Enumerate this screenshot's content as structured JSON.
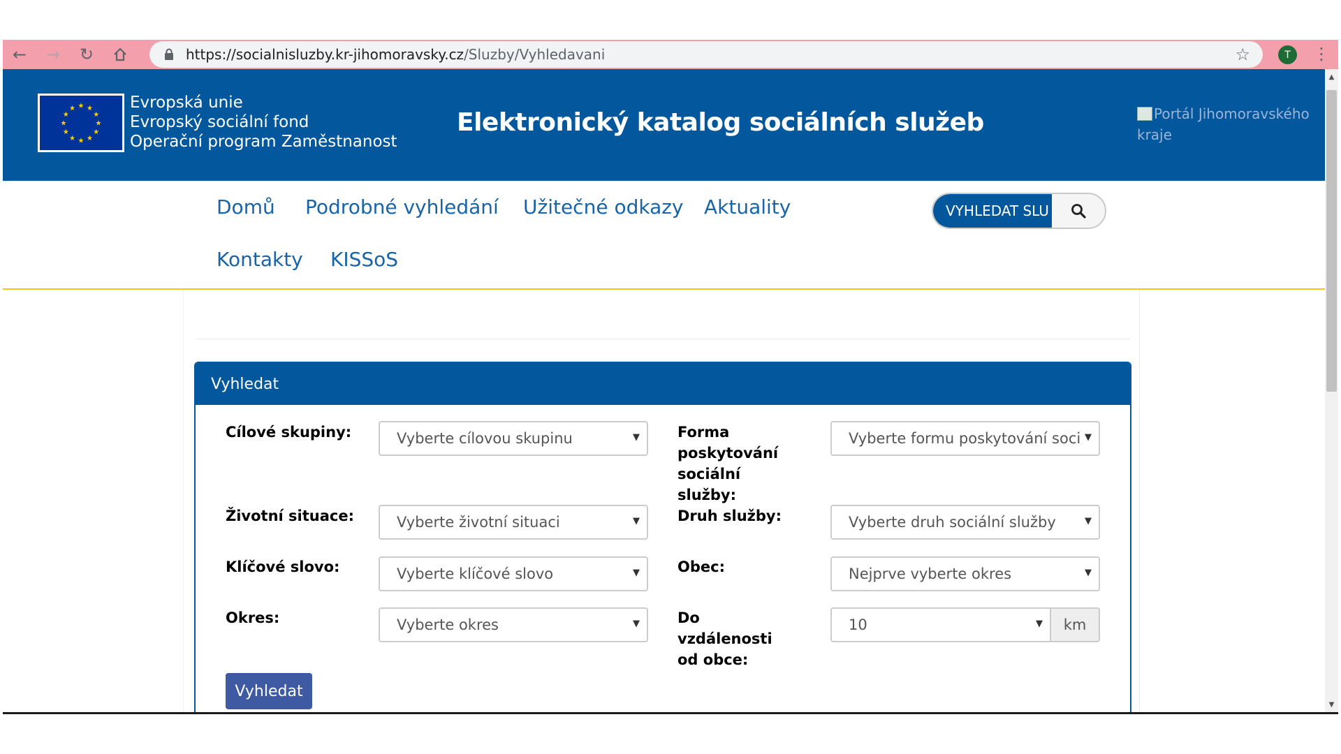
{
  "browser": {
    "url_host": "https://socialnisluzby.kr-jihomoravsky.cz",
    "url_path": "/Sluzby/Vyhledavani",
    "avatar_letter": "T"
  },
  "header": {
    "eu_lines": [
      "Evropská unie",
      "Evropský sociální fond",
      "Operační program Zaměstnanost"
    ],
    "title": "Elektronický katalog sociálních služeb",
    "portal_alt": "Portál Jihomoravského kraje"
  },
  "nav": {
    "items": [
      "Domů",
      "Podrobné vyhledání",
      "Užitečné odkazy",
      "Aktuality",
      "Kontakty",
      "KISSoS"
    ],
    "search_placeholder": "VYHLEDAT SLU"
  },
  "form": {
    "panel_title": "Vyhledat",
    "fields": {
      "target_groups": {
        "label": "Cílové skupiny:",
        "value": "Vyberte cílovou skupinu"
      },
      "service_form": {
        "label": "Forma poskytování sociální služby:",
        "value": "Vyberte formu poskytování soci"
      },
      "life_situation": {
        "label": "Životní situace:",
        "value": "Vyberte životní situaci"
      },
      "service_type": {
        "label": "Druh služby:",
        "value": "Vyberte druh sociální služby"
      },
      "keyword": {
        "label": "Klíčové slovo:",
        "value": "Vyberte klíčové slovo"
      },
      "municipality": {
        "label": "Obec:",
        "value": "Nejprve vyberte okres"
      },
      "district": {
        "label": "Okres:",
        "value": "Vyberte okres"
      },
      "distance": {
        "label": "Do vzdálenosti od obce:",
        "value": "10",
        "unit": "km"
      }
    },
    "submit_label": "Vyhledat"
  },
  "colors": {
    "header_blue": "#03579c",
    "link_blue": "#1864a8",
    "accent_yellow": "#f2c61c",
    "button_blue": "#3e5aa3",
    "chrome_pink": "#f3a0ac"
  },
  "icons": {
    "back": "back-arrow-icon",
    "forward": "forward-arrow-icon",
    "reload": "reload-icon",
    "home": "home-icon",
    "lock": "lock-icon",
    "star": "star-icon",
    "menu": "kebab-menu-icon",
    "search": "search-icon",
    "eu_flag": "eu-flag-icon",
    "caret": "caret-down-icon"
  }
}
